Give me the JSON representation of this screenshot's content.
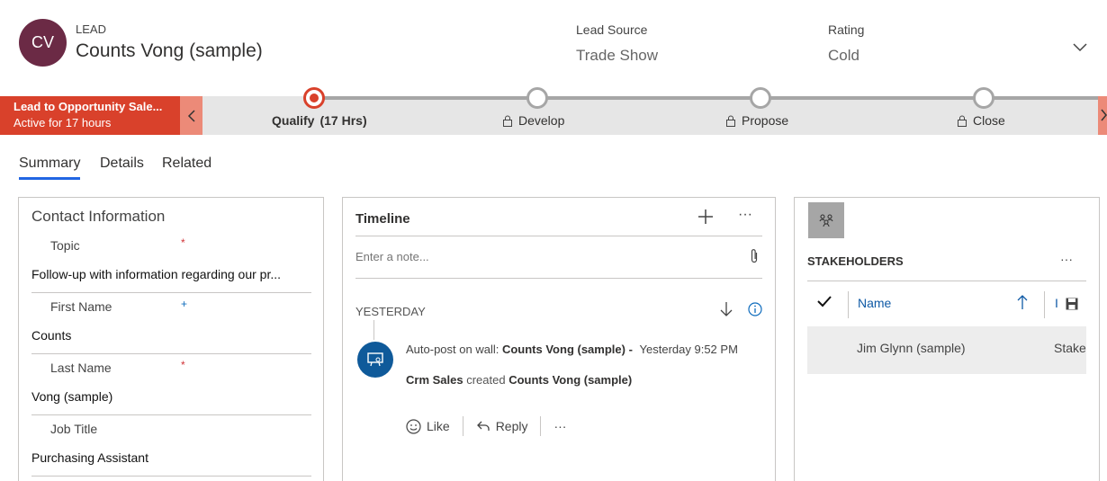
{
  "header": {
    "avatar_initials": "CV",
    "entity_type": "LEAD",
    "record_name": "Counts Vong (sample)",
    "lead_source_label": "Lead Source",
    "lead_source_value": "Trade Show",
    "rating_label": "Rating",
    "rating_value": "Cold",
    "avatar_color": "#6b2a45"
  },
  "process": {
    "name": "Lead to Opportunity Sale...",
    "active_for": "Active for 17 hours",
    "accent_color": "#d9412b",
    "stages": [
      {
        "label": "Qualify",
        "duration": "(17 Hrs)",
        "active": true
      },
      {
        "label": "Develop",
        "locked": true
      },
      {
        "label": "Propose",
        "locked": true
      },
      {
        "label": "Close",
        "locked": true
      }
    ]
  },
  "tabs": [
    "Summary",
    "Details",
    "Related"
  ],
  "contact": {
    "section_title": "Contact Information",
    "fields": [
      {
        "label": "Topic",
        "required": "*",
        "value": "Follow-up with information regarding our pr..."
      },
      {
        "label": "First Name",
        "required": "+",
        "value": "Counts"
      },
      {
        "label": "Last Name",
        "required": "*",
        "value": "Vong (sample)"
      },
      {
        "label": "Job Title",
        "value": "Purchasing Assistant"
      }
    ]
  },
  "timeline": {
    "title": "Timeline",
    "note_placeholder": "Enter a note...",
    "group_label": "YESTERDAY",
    "post": {
      "prefix": "Auto-post on wall:",
      "subject": "Counts Vong (sample) -",
      "time": "Yesterday 9:52 PM",
      "actor": "Crm Sales",
      "verb": "created",
      "target": "Counts Vong (sample)"
    },
    "actions": {
      "like": "Like",
      "reply": "Reply",
      "more": "···"
    },
    "more": "···"
  },
  "stakeholders": {
    "title": "STAKEHOLDERS",
    "more": "···",
    "column_name": "Name",
    "column_second_partial": "I",
    "rows": [
      {
        "name": "Jim Glynn (sample)",
        "role": "Stake"
      }
    ]
  }
}
